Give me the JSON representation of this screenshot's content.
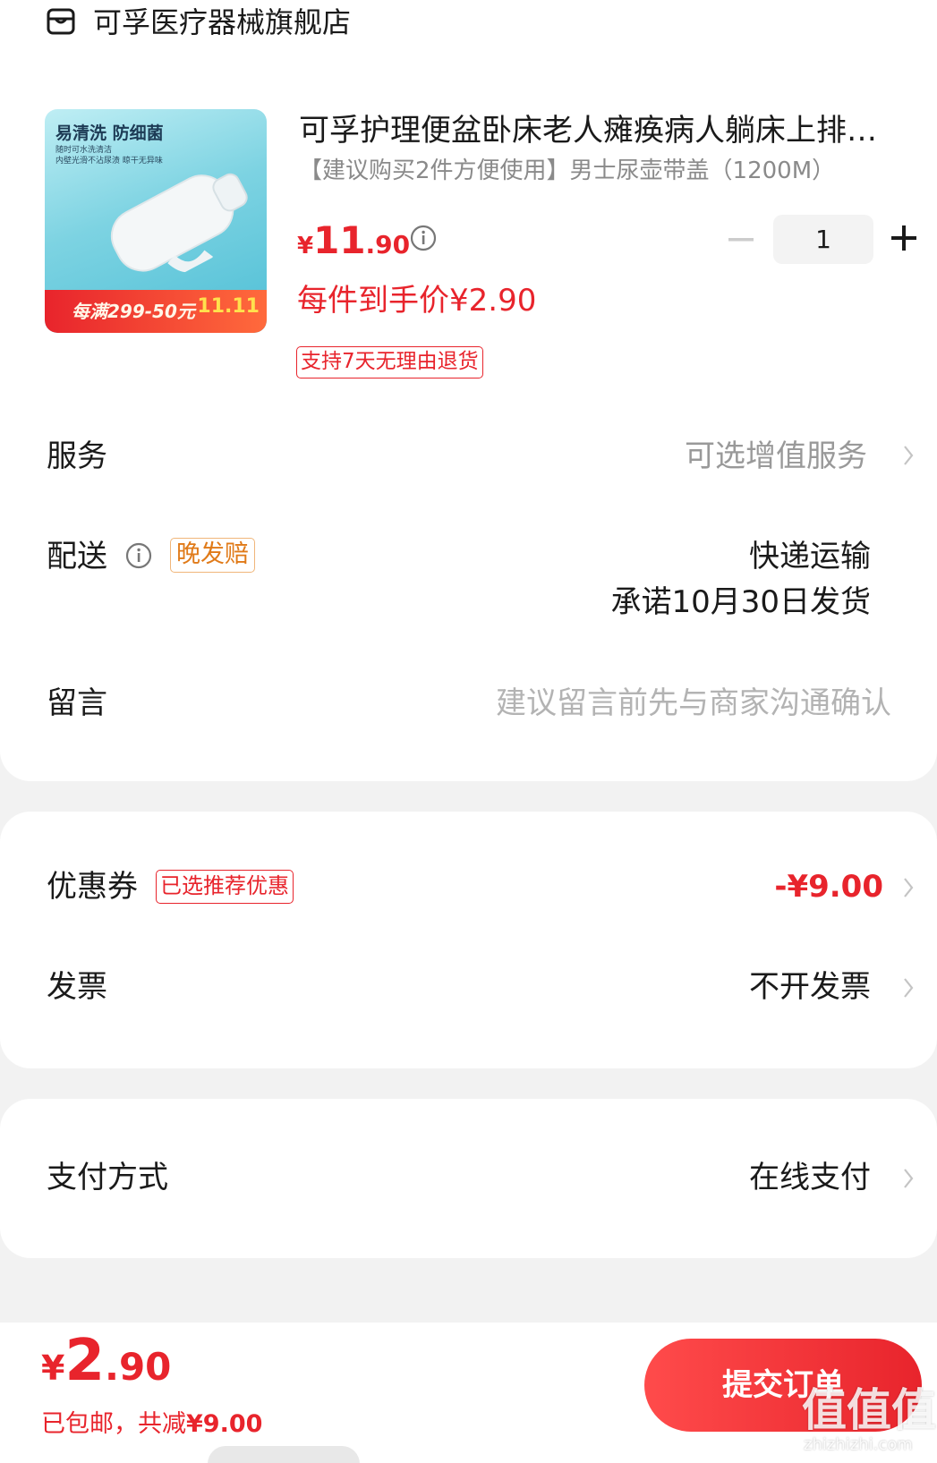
{
  "store": {
    "name": "可孚医疗器械旗舰店",
    "icon": "store-icon"
  },
  "product": {
    "title": "可孚护理便盆卧床老人瘫痪病人躺床上排…",
    "spec": "【建议购买2件方便使用】男士尿壶带盖（1200M）",
    "price": {
      "currency": "¥",
      "integer": "11",
      "decimal": ".90"
    },
    "quantity": "1",
    "unit_price": "每件到手价¥2.90",
    "return_policy": "支持7天无理由退货",
    "image": {
      "headline": "易清洗 防细菌",
      "subline1": "随时可水洗清洁",
      "subline2": "内壁光滑不沾尿渍 晾干无异味",
      "promo": "每满299-50元",
      "event": "11.11"
    }
  },
  "service": {
    "label": "服务",
    "value": "可选增值服务"
  },
  "shipping": {
    "label": "配送",
    "badge": "晚发赔",
    "method": "快递运输",
    "promise": "承诺10月30日发货"
  },
  "message": {
    "label": "留言",
    "placeholder": "建议留言前先与商家沟通确认"
  },
  "coupon": {
    "label": "优惠券",
    "badge": "已选推荐优惠",
    "value": "-¥9.00"
  },
  "invoice": {
    "label": "发票",
    "value": "不开发票"
  },
  "payment": {
    "label": "支付方式",
    "value": "在线支付"
  },
  "footer": {
    "total": {
      "currency": "¥",
      "integer": "2",
      "decimal": ".90"
    },
    "summary_prefix": "已包邮，共减",
    "summary_amount": "¥9.00",
    "submit_label": "提交订单",
    "watermark": "值值值",
    "watermark_sub": "zhizhizhi.com"
  },
  "colors": {
    "accent": "#e8242c",
    "muted": "#999999",
    "late_badge": "#e07a18",
    "background": "#f2f2f2"
  }
}
